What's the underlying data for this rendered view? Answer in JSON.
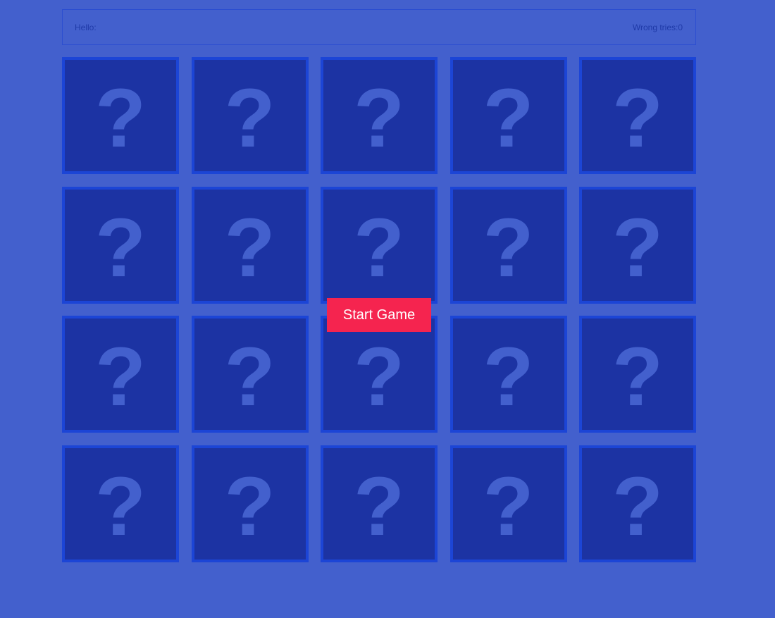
{
  "header": {
    "hello_label": "Hello:",
    "wrong_tries_label": "Wrong tries:0"
  },
  "board": {
    "rows": 4,
    "columns": 5,
    "card_symbol": "?",
    "card_back_color": "#1c33a3",
    "card_border_color": "#1c45d6"
  },
  "start_button": {
    "label": "Start Game",
    "color": "#f5244f"
  },
  "colors": {
    "background": "#4360cd",
    "text": "#1f3aa8"
  }
}
